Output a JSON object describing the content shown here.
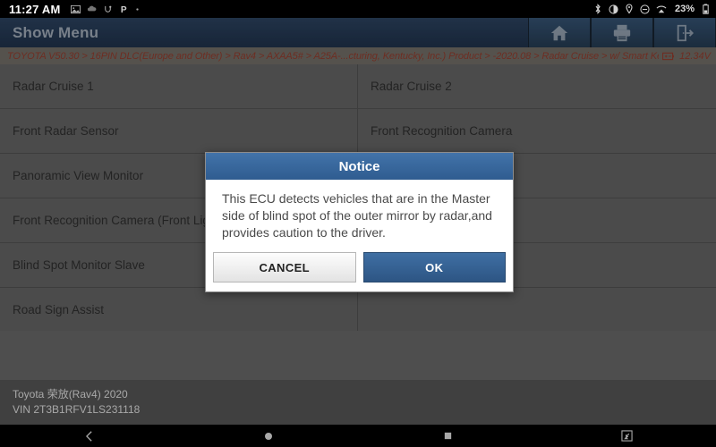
{
  "status_bar": {
    "time": "11:27 AM",
    "left_icons": [
      "image-icon",
      "cloud-icon",
      "usb-icon",
      "parking-p-icon",
      "dot-icon"
    ],
    "right_icons": [
      "bluetooth-icon",
      "brightness-icon",
      "location-icon",
      "do-not-disturb-icon",
      "wifi-icon"
    ],
    "battery_percent": "23%",
    "battery_icon": "battery-icon"
  },
  "app_header": {
    "title": "Show Menu",
    "buttons": [
      {
        "name": "home-button",
        "icon": "home-icon"
      },
      {
        "name": "print-button",
        "icon": "printer-icon"
      },
      {
        "name": "exit-button",
        "icon": "exit-icon"
      }
    ]
  },
  "breadcrumb": {
    "path": "TOYOTA V50.30 > 16PIN DLC(Europe and Other) > Rav4 > AXAA5# > A25A-...cturing, Kentucky, Inc.) Product > -2020.08 > Radar Cruise > w/ Smart Key",
    "battery_icon": "battery-voltage-icon",
    "voltage": "12.34V"
  },
  "menu": {
    "rows": [
      {
        "left": "Radar Cruise 1",
        "right": "Radar Cruise 2"
      },
      {
        "left": "Front Radar Sensor",
        "right": "Front Recognition Camera"
      },
      {
        "left": "Panoramic View Monitor",
        "right": ""
      },
      {
        "left": "Front Recognition Camera (Front Light Control)",
        "right": ""
      },
      {
        "left": "Blind Spot Monitor Slave",
        "right": ""
      },
      {
        "left": "Road Sign Assist",
        "right": ""
      }
    ]
  },
  "footer": {
    "vehicle": "Toyota 荣放(Rav4) 2020",
    "vin": "VIN 2T3B1RFV1LS231118"
  },
  "dialog": {
    "title": "Notice",
    "message": "This ECU detects vehicles that are in the Master side of blind spot of the outer mirror by radar,and provides caution to the driver.",
    "cancel_label": "CANCEL",
    "ok_label": "OK"
  },
  "nav_bar": {
    "buttons": [
      "back-icon",
      "home-circle-icon",
      "recents-square-icon",
      "screenshot-icon"
    ]
  },
  "colors": {
    "accent_blue": "#2f5c90",
    "header_navy": "#2a405c",
    "breadcrumb_text": "#8d3a2c",
    "list_bg": "#616161"
  }
}
